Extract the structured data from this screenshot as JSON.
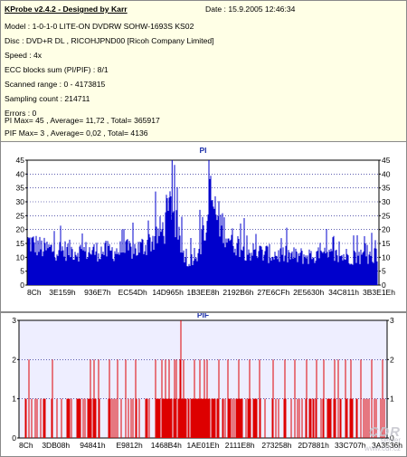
{
  "header": {
    "title": "KProbe v2.4.2 - Designed by Karr",
    "date": "Date : 15.9.2005 12:46:34",
    "lines": [
      "Model : 1-0-1-0 LITE-ON DVDRW SOHW-1693S KS02",
      "Disc : DVD+R DL , RICOHJPND00 [Ricoh Company Limited]",
      "Speed : 4x",
      "ECC blocks sum (PI/PIF) : 8/1",
      "Scanned range : 0 - 4173815",
      "Sampling count : 214711",
      "Errors : 0",
      "PI Max= 45 , Average= 11,72 , Total= 365917",
      "PIF Max= 3 , Average= 0,02 , Total= 4136"
    ]
  },
  "colors": {
    "pi_bars": "#0000cc",
    "pif_bars": "#dd0000",
    "title": "#1c2fa8",
    "grid": "#000080",
    "plot_bg_pif": "#eeeeff"
  },
  "chart_data": [
    {
      "type": "bar",
      "title": "PI",
      "ylim": [
        0,
        45
      ],
      "yticks": [
        0,
        5,
        10,
        15,
        20,
        25,
        30,
        35,
        40,
        45
      ],
      "xticks": [
        "8Ch",
        "3E159h",
        "936E7h",
        "EC54Dh",
        "14D965h",
        "1B3EE8h",
        "2192B6h",
        "27E6CFh",
        "2E5630h",
        "34C811h",
        "3B3E1Eh"
      ],
      "grid": true,
      "x_range": [
        140,
        4173815
      ],
      "profile": [
        {
          "x": 140,
          "y": 18
        },
        {
          "x": 180000,
          "y": 15
        },
        {
          "x": 600000,
          "y": 14
        },
        {
          "x": 1050000,
          "y": 14
        },
        {
          "x": 1330000,
          "y": 15
        },
        {
          "x": 1500000,
          "y": 19
        },
        {
          "x": 1640000,
          "y": 24
        },
        {
          "x": 1720000,
          "y": 35
        },
        {
          "x": 1790000,
          "y": 20
        },
        {
          "x": 1900000,
          "y": 9
        },
        {
          "x": 2020000,
          "y": 14
        },
        {
          "x": 2120000,
          "y": 21
        },
        {
          "x": 2180000,
          "y": 37
        },
        {
          "x": 2260000,
          "y": 28
        },
        {
          "x": 2420000,
          "y": 19
        },
        {
          "x": 2620000,
          "y": 14
        },
        {
          "x": 2850000,
          "y": 13
        },
        {
          "x": 3200000,
          "y": 12
        },
        {
          "x": 3700000,
          "y": 12
        },
        {
          "x": 4173815,
          "y": 12
        }
      ],
      "max": 45,
      "average": 11.72
    },
    {
      "type": "bar",
      "title": "PIF",
      "ylim": [
        0,
        3
      ],
      "yticks": [
        0,
        1,
        2,
        3
      ],
      "xticks": [
        "8Ch",
        "3DB08h",
        "94841h",
        "E9812h",
        "1468B4h",
        "1AE01Eh",
        "2111E8h",
        "273258h",
        "2D7881h",
        "33C707h",
        "3A3536h"
      ],
      "grid": true,
      "x_range": [
        140,
        4173815
      ],
      "spikes_value_2_at": [
        110000,
        380000,
        810000,
        850000,
        900000,
        1030000,
        1120000,
        1210000,
        1320000,
        1550000,
        1620000,
        1660000,
        1700000,
        1760000,
        1780000,
        1830000,
        1870000,
        1990000,
        2050000,
        2100000,
        2130000,
        2270000,
        2370000,
        2490000,
        2620000,
        2730000,
        2880000,
        3010000,
        3130000,
        3260000,
        3370000,
        3460000,
        3580000,
        3620000,
        3700000,
        3760000,
        3880000,
        4000000,
        4120000
      ],
      "spike_value_3_at": 1840000,
      "max": 3,
      "average": 0.02
    }
  ],
  "watermark": {
    "logo": "CDR",
    "sub": "server",
    "url": "www.cdr.cz"
  }
}
